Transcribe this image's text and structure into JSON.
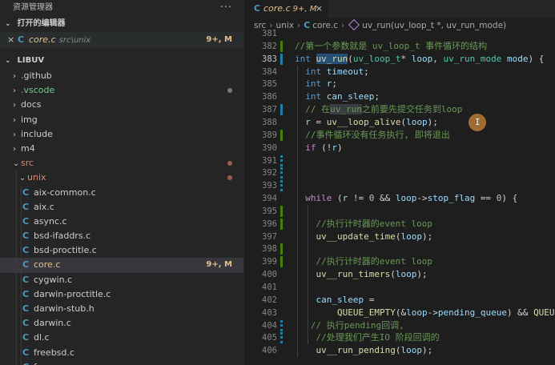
{
  "sidebar": {
    "title": "资源管理器",
    "more": "···",
    "open_editors_label": "打开的编辑器",
    "open_editor": {
      "close": "×",
      "icon": "C",
      "name": "core.c",
      "path": "src\\unix",
      "badge": "9+, M"
    },
    "project_label": "LIBUV",
    "tree": [
      {
        "label": ".github",
        "arrow": "›",
        "level": 1,
        "color": "normal",
        "dot": ""
      },
      {
        "label": ".vscode",
        "arrow": "›",
        "level": 1,
        "color": "green",
        "dot": "gray"
      },
      {
        "label": "docs",
        "arrow": "›",
        "level": 1,
        "color": "normal",
        "dot": ""
      },
      {
        "label": "img",
        "arrow": "›",
        "level": 1,
        "color": "normal",
        "dot": ""
      },
      {
        "label": "include",
        "arrow": "›",
        "level": 1,
        "color": "normal",
        "dot": ""
      },
      {
        "label": "m4",
        "arrow": "›",
        "level": 1,
        "color": "normal",
        "dot": ""
      },
      {
        "label": "src",
        "arrow": "⌄",
        "level": 1,
        "color": "red",
        "dot": "red"
      },
      {
        "label": "unix",
        "arrow": "⌄",
        "level": 2,
        "color": "red",
        "dot": "red"
      },
      {
        "label": "aix-common.c",
        "icon": "C",
        "level": 3,
        "color": "normal",
        "dot": ""
      },
      {
        "label": "aix.c",
        "icon": "C",
        "level": 3,
        "color": "normal",
        "dot": ""
      },
      {
        "label": "async.c",
        "icon": "C",
        "level": 3,
        "color": "normal",
        "dot": ""
      },
      {
        "label": "bsd-ifaddrs.c",
        "icon": "C",
        "level": 3,
        "color": "normal",
        "dot": ""
      },
      {
        "label": "bsd-proctitle.c",
        "icon": "C",
        "level": 3,
        "color": "normal",
        "dot": ""
      },
      {
        "label": "core.c",
        "icon": "C",
        "level": 3,
        "color": "mod",
        "badge": "9+, M",
        "selected": true,
        "dot": ""
      },
      {
        "label": "cygwin.c",
        "icon": "C",
        "level": 3,
        "color": "normal",
        "dot": ""
      },
      {
        "label": "darwin-proctitle.c",
        "icon": "C",
        "level": 3,
        "color": "normal",
        "dot": ""
      },
      {
        "label": "darwin-stub.h",
        "icon": "C",
        "level": 3,
        "color": "normal",
        "dot": ""
      },
      {
        "label": "darwin.c",
        "icon": "C",
        "level": 3,
        "color": "normal",
        "dot": ""
      },
      {
        "label": "dl.c",
        "icon": "C",
        "level": 3,
        "color": "normal",
        "dot": ""
      },
      {
        "label": "freebsd.c",
        "icon": "C",
        "level": 3,
        "color": "normal",
        "dot": ""
      },
      {
        "label": "fs.c",
        "icon": "C",
        "level": 3,
        "color": "normal",
        "dot": ""
      }
    ]
  },
  "tab": {
    "icon": "C",
    "name": "core.c",
    "badge": "9+, M",
    "close": "×"
  },
  "breadcrumb": {
    "parts": [
      "src",
      "unix",
      "core.c"
    ],
    "file_icon": "C",
    "symbol": "uv_run(uv_loop_t *, uv_run_mode)"
  },
  "code": {
    "current_line": 383,
    "lines": [
      {
        "n": 381,
        "gutter": "",
        "html": ""
      },
      {
        "n": 382,
        "gutter": "add",
        "html": "<span class=\"cm\">//第一个参数就是 uv_loop_t 事件循环的结构</span>"
      },
      {
        "n": 383,
        "gutter": "mod",
        "html": "<span class=\"kw\">int</span> <span class=\"fn hl\">uv_run</span>(<span class=\"ty\">uv_loop_t</span>* <span class=\"vr\">loop</span>, <span class=\"ty\">uv_run_mode</span> <span class=\"vr\">mode</span>) {"
      },
      {
        "n": 384,
        "gutter": "",
        "html": "  <span class=\"kw\">int</span> <span class=\"vr\">timeout</span>;"
      },
      {
        "n": 385,
        "gutter": "",
        "html": "  <span class=\"kw\">int</span> <span class=\"vr\">r</span>;"
      },
      {
        "n": 386,
        "gutter": "",
        "html": "  <span class=\"kw\">int</span> <span class=\"vr\">can_sleep</span>;"
      },
      {
        "n": 387,
        "gutter": "mod",
        "html": "  <span class=\"cm\">// 在<span class=\"hl2\">uv_run</span>之前要先提交任务到loop</span>"
      },
      {
        "n": 388,
        "gutter": "",
        "html": "  <span class=\"vr\">r</span> = <span class=\"fn\">uv__loop_alive</span>(<span class=\"vr\">loop</span>);"
      },
      {
        "n": 389,
        "gutter": "add",
        "html": "  <span class=\"cm\">//事件循环没有任务执行, 即将退出</span>"
      },
      {
        "n": 390,
        "gutter": "",
        "html": "  <span class=\"kc\">if</span> (!<span class=\"vr\">r</span>)"
      },
      {
        "n": 391,
        "gutter": "del",
        "html": ""
      },
      {
        "n": 392,
        "gutter": "del",
        "html": ""
      },
      {
        "n": 393,
        "gutter": "del",
        "html": ""
      },
      {
        "n": 394,
        "gutter": "",
        "html": "  <span class=\"kc\">while</span> (<span class=\"vr\">r</span> != <span class=\"nm\">0</span> &amp;&amp; <span class=\"vr\">loop</span>-&gt;<span class=\"vr\">stop_flag</span> == <span class=\"nm\">0</span>) {"
      },
      {
        "n": 395,
        "gutter": "add",
        "html": ""
      },
      {
        "n": 396,
        "gutter": "add",
        "html": "    <span class=\"cm\">//执行计时器的event loop</span>"
      },
      {
        "n": 397,
        "gutter": "",
        "html": "    <span class=\"fn\">uv__update_time</span>(<span class=\"vr\">loop</span>);"
      },
      {
        "n": 398,
        "gutter": "add",
        "html": ""
      },
      {
        "n": 399,
        "gutter": "add",
        "html": "    <span class=\"cm\">//执行计时器的event loop</span>"
      },
      {
        "n": 400,
        "gutter": "",
        "html": "    <span class=\"fn\">uv__run_timers</span>(<span class=\"vr\">loop</span>);"
      },
      {
        "n": 401,
        "gutter": "",
        "html": ""
      },
      {
        "n": 402,
        "gutter": "",
        "html": "    <span class=\"vr\">can_sleep</span> ="
      },
      {
        "n": 403,
        "gutter": "",
        "html": "        <span class=\"fn\">QUEUE_EMPTY</span>(&amp;<span class=\"vr\">loop</span>-&gt;<span class=\"vr\">pending_queue</span>) &amp;&amp; <span class=\"fn\">QUEUE_</span>"
      },
      {
        "n": 404,
        "gutter": "del",
        "html": "   <span class=\"cm\">// 执行pending回调,</span>"
      },
      {
        "n": 405,
        "gutter": "del",
        "html": "    <span class=\"cm\">//处理我们产生IO 阶段回调的</span>"
      },
      {
        "n": 406,
        "gutter": "",
        "html": "    <span class=\"fn\">uv__run_pending</span>(<span class=\"vr\">loop</span>);"
      }
    ]
  },
  "cursor_glyph": "I",
  "colors": {
    "accent": "#007acc",
    "modified": "#e2c08d",
    "error_red": "#e0866f"
  }
}
